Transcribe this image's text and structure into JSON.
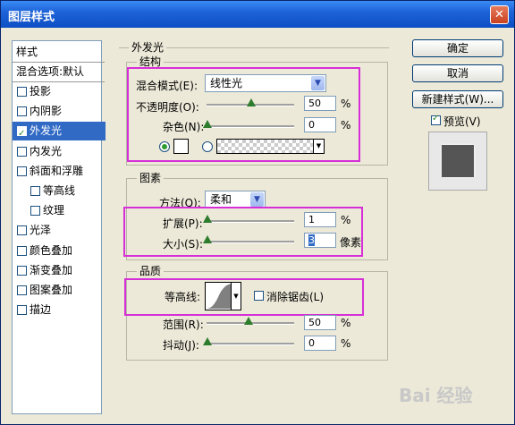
{
  "window": {
    "title": "图层样式",
    "close_glyph": "✕"
  },
  "left_panel": {
    "header": "样式",
    "blend_default": "混合选项:默认",
    "items": [
      {
        "label": "投影",
        "checked": false
      },
      {
        "label": "内阴影",
        "checked": false
      },
      {
        "label": "外发光",
        "checked": true,
        "selected": true
      },
      {
        "label": "内发光",
        "checked": false
      },
      {
        "label": "斜面和浮雕",
        "checked": false
      },
      {
        "label": "等高线",
        "checked": false
      },
      {
        "label": "纹理",
        "checked": false
      },
      {
        "label": "光泽",
        "checked": false
      },
      {
        "label": "颜色叠加",
        "checked": false
      },
      {
        "label": "渐变叠加",
        "checked": false
      },
      {
        "label": "图案叠加",
        "checked": false
      },
      {
        "label": "描边",
        "checked": false
      }
    ]
  },
  "main": {
    "section_title": "外发光",
    "structure": {
      "title": "结构",
      "blend_mode_label": "混合模式(E):",
      "blend_mode_value": "线性光",
      "opacity_label": "不透明度(O):",
      "opacity_value": "50",
      "noise_label": "杂色(N):",
      "noise_value": "0",
      "percent": "%"
    },
    "elements": {
      "title": "图素",
      "method_label": "方法(Q):",
      "method_value": "柔和",
      "spread_label": "扩展(P):",
      "spread_value": "1",
      "size_label": "大小(S):",
      "size_value": "3",
      "pixel_unit": "像素",
      "percent": "%"
    },
    "quality": {
      "title": "品质",
      "contour_label": "等高线:",
      "antialias_label": "消除锯齿(L)",
      "range_label": "范围(R):",
      "range_value": "50",
      "jitter_label": "抖动(J):",
      "jitter_value": "0",
      "percent": "%"
    }
  },
  "buttons": {
    "ok": "确定",
    "cancel": "取消",
    "new_style": "新建样式(W)...",
    "preview_label": "预览(V)",
    "preview_checked": true
  },
  "watermark": "Bai 经验"
}
